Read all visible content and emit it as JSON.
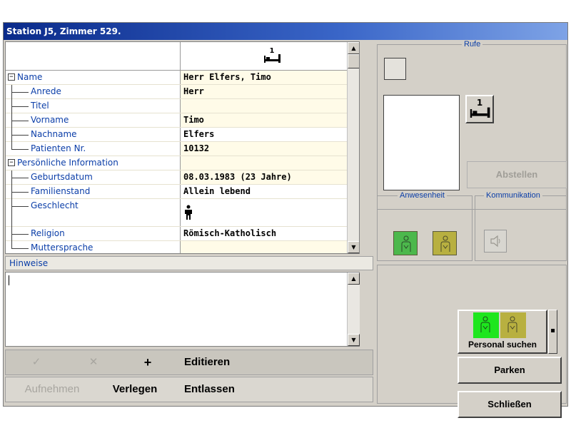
{
  "window": {
    "title": "Station J5, Zimmer 529."
  },
  "grid": {
    "header_bed_number": "1",
    "rows": [
      {
        "label": "Name",
        "value": "Herr Elfers, Timo",
        "level": 0
      },
      {
        "label": "Anrede",
        "value": "Herr",
        "level": 1
      },
      {
        "label": "Titel",
        "value": "",
        "level": 1
      },
      {
        "label": "Vorname",
        "value": "Timo",
        "level": 1
      },
      {
        "label": "Nachname",
        "value": "Elfers",
        "level": 1
      },
      {
        "label": "Patienten Nr.",
        "value": "10132",
        "level": 1
      },
      {
        "label": "Persönliche Information",
        "value": "",
        "level": 0
      },
      {
        "label": "Geburtsdatum",
        "value": "08.03.1983 (23 Jahre)",
        "level": 1
      },
      {
        "label": "Familienstand",
        "value": "Allein lebend",
        "level": 1
      },
      {
        "label": "Geschlecht",
        "value": "",
        "level": 1,
        "icon": "male-icon"
      },
      {
        "label": "Religion",
        "value": "Römisch-Katholisch",
        "level": 1
      },
      {
        "label": "Muttersprache",
        "value": "",
        "level": 1
      }
    ]
  },
  "hinweise": {
    "label": "Hinweise",
    "text": ""
  },
  "buttons": {
    "accept_symbol": "✓",
    "cancel_symbol": "✕",
    "add_symbol": "+",
    "editieren": "Editieren",
    "aufnehmen": "Aufnehmen",
    "verlegen": "Verlegen",
    "entlassen": "Entlassen"
  },
  "rufe": {
    "label": "Rufe",
    "bed_number": "1",
    "abstellen": "Abstellen"
  },
  "anwesenheit": {
    "label": "Anwesenheit"
  },
  "kommunikation": {
    "label": "Kommunikation"
  },
  "actions": {
    "personal_suchen": "Personal suchen",
    "parken": "Parken",
    "schliessen": "Schließen"
  },
  "colors": {
    "title_start": "#0a2a8a",
    "value_bg": "#fffbe8",
    "label_blue": "#0b3ea8",
    "presence_green": "#4cb84c",
    "presence_olive": "#b8b040",
    "bright_green": "#1ee61e"
  }
}
